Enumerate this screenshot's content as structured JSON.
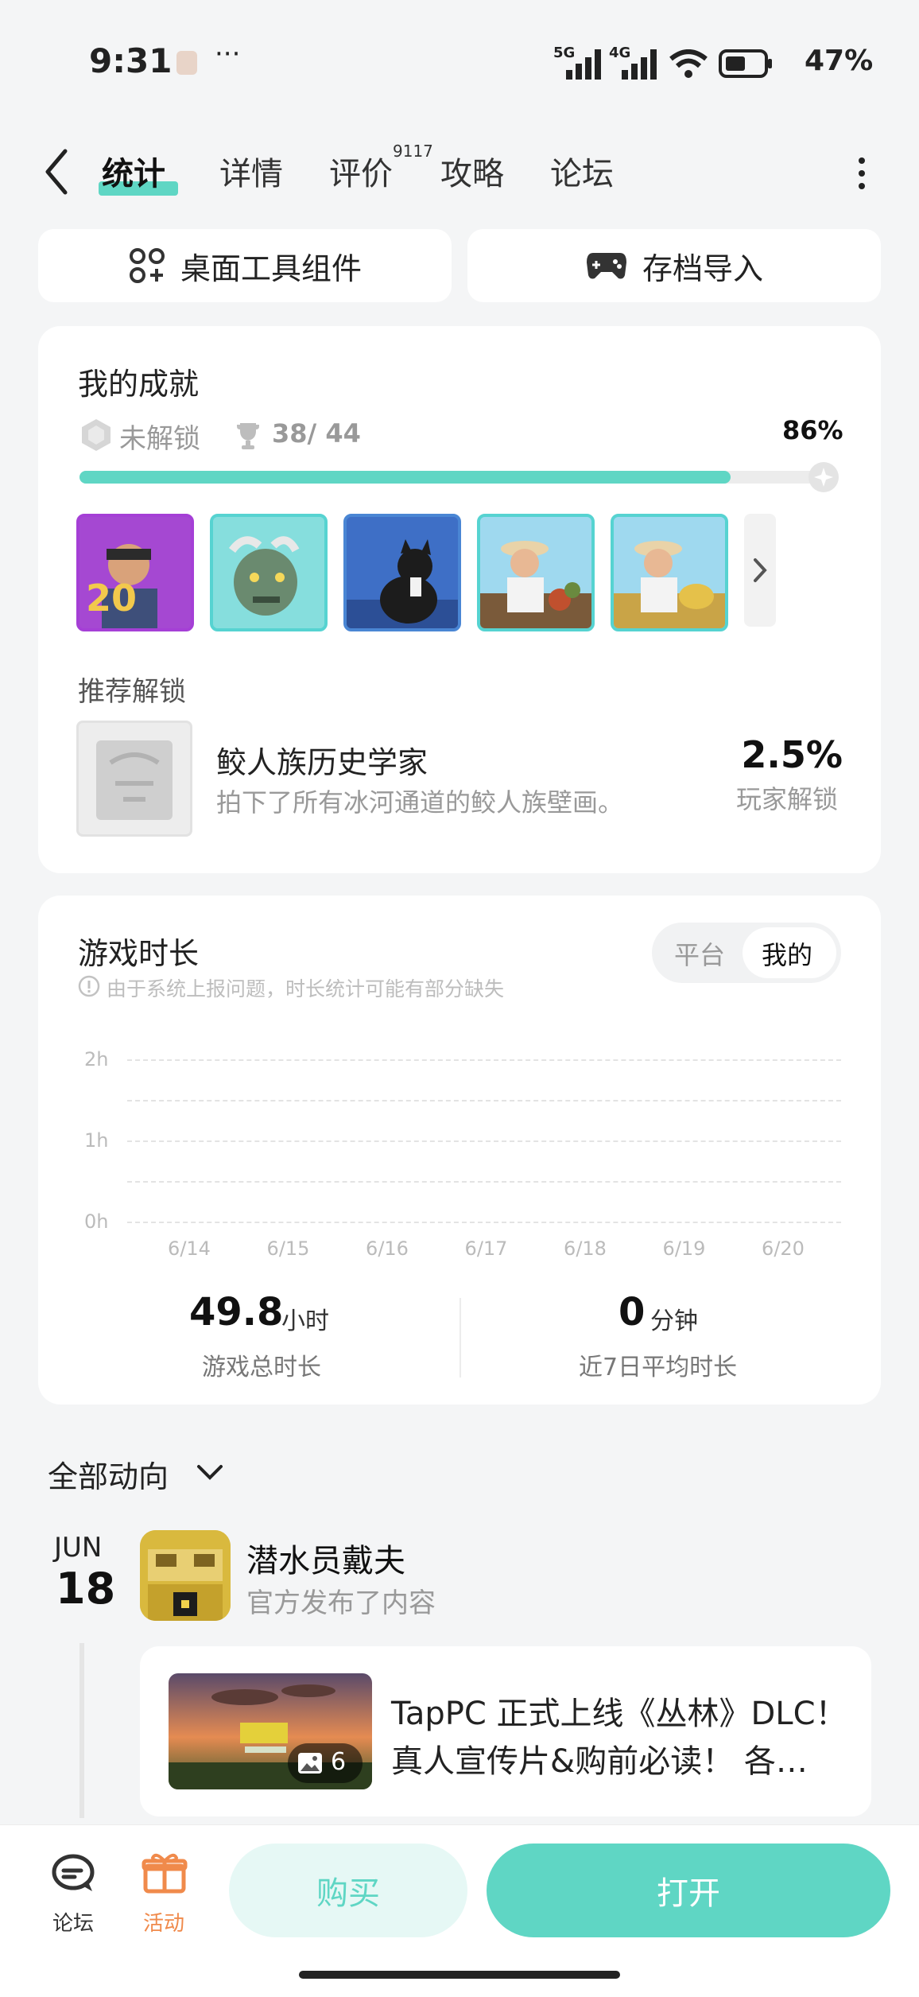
{
  "status_bar": {
    "time": "9:31",
    "dots": "···",
    "signal_1": "5G",
    "signal_2": "4G",
    "battery": "47%"
  },
  "tabs": [
    {
      "label": "统计"
    },
    {
      "label": "详情"
    },
    {
      "label": "评价"
    },
    {
      "label": "攻略"
    },
    {
      "label": "论坛"
    }
  ],
  "review_count": "9117",
  "tools": {
    "widget_label": "桌面工具组件",
    "save_import_label": "存档导入"
  },
  "achievements": {
    "title": "我的成就",
    "locked_label": "未解锁",
    "count": "38/ 44",
    "percent_text": "86%",
    "progress": 0.86,
    "recommend_title": "推荐解锁",
    "recommended": {
      "name": "鲛人族历史学家",
      "desc": "拍下了所有冰河通道的鲛人族壁画。",
      "rate": "2.5%",
      "rate_label": "玩家解锁"
    }
  },
  "playtime": {
    "title": "游戏时长",
    "note": "由于系统上报问题，时长统计可能有部分缺失",
    "toggle": {
      "platform": "平台",
      "mine": "我的"
    },
    "total_value": "49.8",
    "total_unit": "小时",
    "total_label": "游戏总时长",
    "avg_value": "0",
    "avg_unit": "分钟",
    "avg_label": "近7日平均时长"
  },
  "chart_data": {
    "type": "bar",
    "categories": [
      "6/14",
      "6/15",
      "6/16",
      "6/17",
      "6/18",
      "6/19",
      "6/20"
    ],
    "values": [
      0,
      0,
      0,
      0,
      0,
      0,
      0
    ],
    "y_ticks": [
      "2h",
      "1h",
      "0h"
    ],
    "ylim": [
      0,
      2
    ],
    "grid": true
  },
  "feed": {
    "filter_label": "全部动向",
    "month": "JUN",
    "day": "18",
    "author": "潜水员戴夫",
    "action": "官方发布了内容",
    "post_title_line1": "TapPC 正式上线《丛林》DLC！",
    "post_title_line2": "真人宣传片&购前必读！ 各…",
    "image_count": "6"
  },
  "bottom_nav": {
    "forum": "论坛",
    "activity": "活动",
    "buy": "购买",
    "open": "打开"
  },
  "colors": {
    "accent": "#5fd6c4",
    "activity": "#f08a4b"
  }
}
